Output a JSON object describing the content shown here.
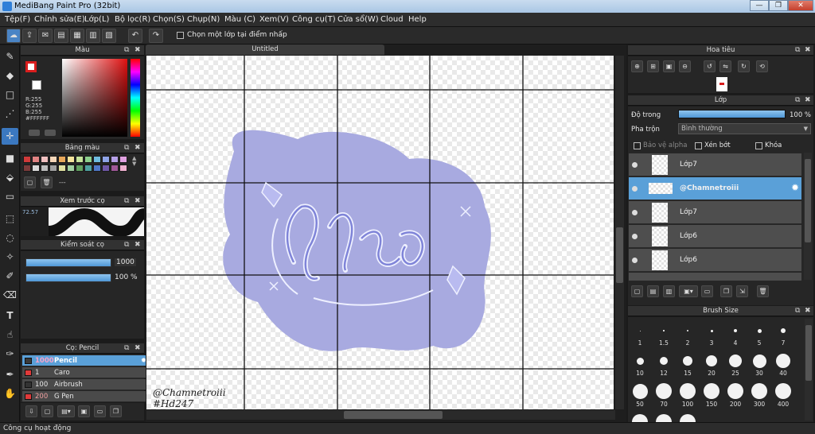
{
  "window": {
    "title": "MediBang Paint Pro (32bit)",
    "minimize": "—",
    "restore": "❐",
    "close": "✕"
  },
  "menu": [
    "Tệp(F)",
    "Chỉnh sửa(E)",
    "Lớp(L)",
    "Bộ lọc(R)",
    "Chọn(S)",
    "Chụp(N)",
    "Màu (C)",
    "Xem(V)",
    "Công cụ(T)",
    "Cửa sổ(W)",
    "Cloud",
    "Help"
  ],
  "toolbar": {
    "select_single_layer_label": "Chọn một lớp tại điểm nhấp"
  },
  "color_panel": {
    "title": "Màu",
    "r": "R:255",
    "g": "G:255",
    "b": "B:255",
    "hex": "#FFFFFF",
    "foreground": "#ffffff",
    "accent": "#d91d1d"
  },
  "palette_panel": {
    "title": "Bảng màu",
    "dashes": "---",
    "swatches": [
      "#cf3a3a",
      "#e08383",
      "#f0c0c0",
      "#f5d6b8",
      "#e8a85a",
      "#f4e39b",
      "#c6e39b",
      "#8ccf8c",
      "#6fbce0",
      "#8fa4e8",
      "#b6a0e8",
      "#e0a0e0",
      "#7b3b3b",
      "#d9d9d9",
      "#bdbdbd",
      "#a0a0a0",
      "#e0e0a0",
      "#a0d0a0",
      "#60a060",
      "#4ea0a0",
      "#5078c8",
      "#7058a8",
      "#a05898",
      "#f0b0d0"
    ]
  },
  "preview_panel": {
    "title": "Xem trước cọ",
    "size": "72.57"
  },
  "brush_control_panel": {
    "title": "Kiểm soát cọ",
    "size_value": "1000",
    "opacity_value": "100 %"
  },
  "brush_panel": {
    "title": "Cọ: Pencil",
    "items": [
      {
        "size": "1000",
        "name": "Pencil",
        "color": "#3a3a3a"
      },
      {
        "size": "1",
        "name": "Caro",
        "color": "#e03a3a"
      },
      {
        "size": "100",
        "name": "Airbrush",
        "color": "#333333"
      },
      {
        "size": "200",
        "name": "G Pen",
        "color": "#e03a3a"
      }
    ]
  },
  "canvas": {
    "tab": "Untitled",
    "signature_line1": "@Chamnetroiii",
    "signature_line2": "#Hd247"
  },
  "navigator_panel": {
    "title": "Hoa tiêu"
  },
  "layer_panel": {
    "title": "Lớp",
    "opacity_label": "Độ trong",
    "opacity_value": "100 %",
    "opacity_fraction": 1.0,
    "blend_label": "Pha trộn",
    "blend_value": "Bình thường",
    "protect_alpha_label": "Bảo vệ alpha",
    "clipping_label": "Xén bớt",
    "lock_label": "Khóa",
    "layers": [
      {
        "name": "Lớp7",
        "selected": false
      },
      {
        "name": "@Chamnetroiii",
        "selected": true
      },
      {
        "name": "Lớp7",
        "selected": false
      },
      {
        "name": "Lớp6",
        "selected": false
      },
      {
        "name": "Lớp6",
        "selected": false
      }
    ]
  },
  "brush_size_panel": {
    "title": "Brush Size",
    "sizes": [
      "1",
      "1.5",
      "2",
      "3",
      "4",
      "5",
      "7",
      "10",
      "12",
      "15",
      "20",
      "25",
      "30",
      "40",
      "50",
      "70",
      "100",
      "150",
      "200",
      "300",
      "400"
    ]
  },
  "status": {
    "text": "Công cụ hoạt động"
  }
}
